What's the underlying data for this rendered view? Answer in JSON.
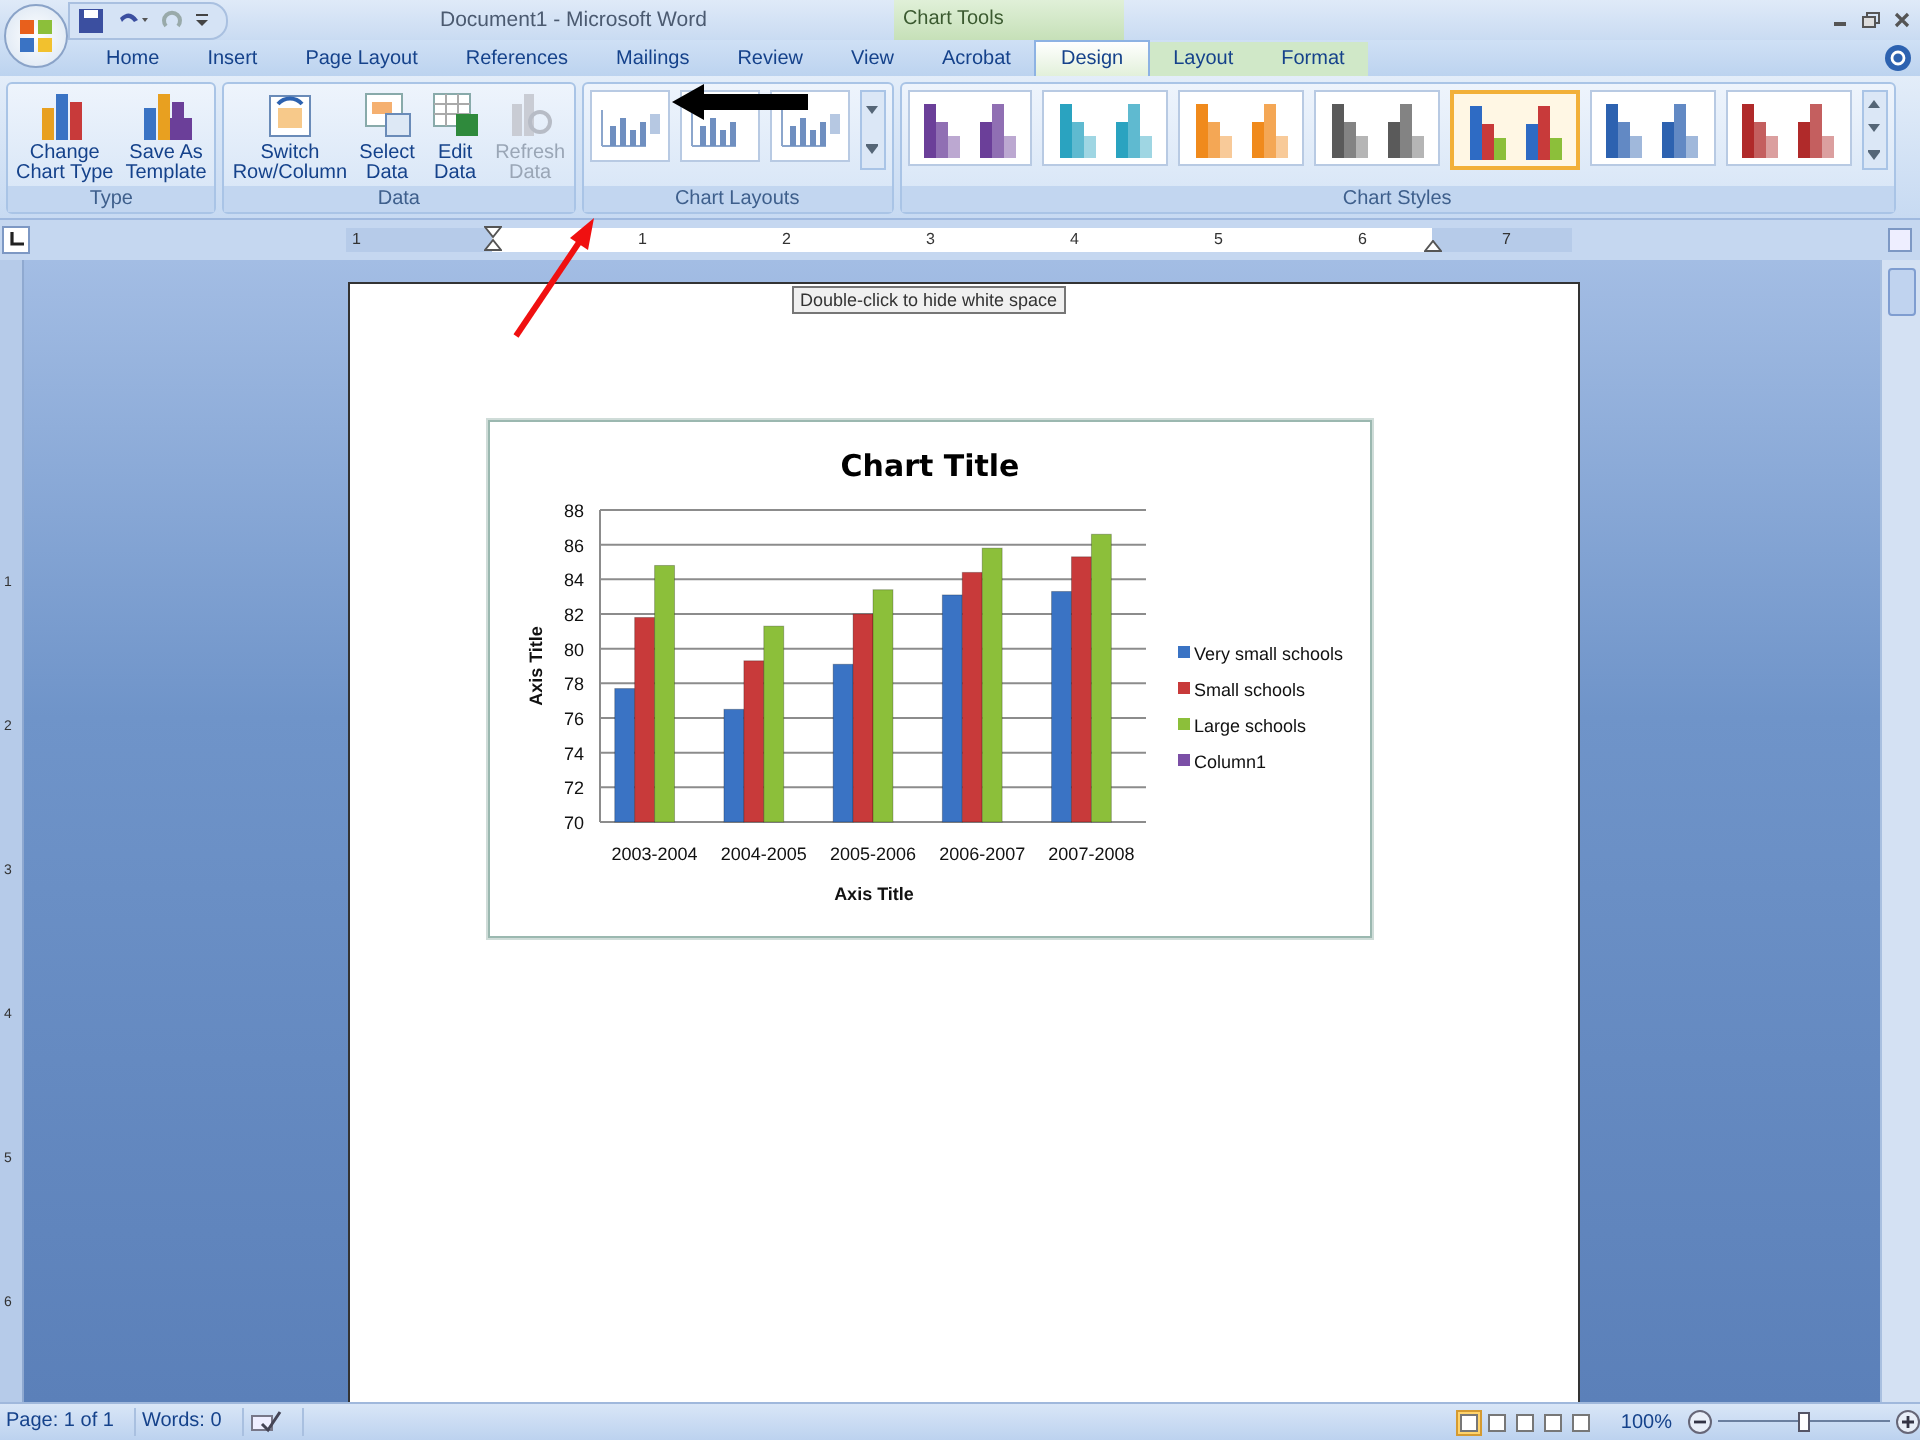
{
  "window": {
    "title": "Document1 - Microsoft Word",
    "context_title": "Chart Tools"
  },
  "tabs": [
    {
      "label": "Home",
      "selected": false,
      "context": false
    },
    {
      "label": "Insert",
      "selected": false,
      "context": false
    },
    {
      "label": "Page Layout",
      "selected": false,
      "context": false
    },
    {
      "label": "References",
      "selected": false,
      "context": false
    },
    {
      "label": "Mailings",
      "selected": false,
      "context": false
    },
    {
      "label": "Review",
      "selected": false,
      "context": false
    },
    {
      "label": "View",
      "selected": false,
      "context": false
    },
    {
      "label": "Acrobat",
      "selected": false,
      "context": false
    },
    {
      "label": "Design",
      "selected": true,
      "context": true
    },
    {
      "label": "Layout",
      "selected": false,
      "context": true
    },
    {
      "label": "Format",
      "selected": false,
      "context": true
    }
  ],
  "ribbon": {
    "type_group": {
      "label": "Type",
      "buttons": [
        {
          "kind": "chart-type",
          "lines": [
            "Change",
            "Chart Type"
          ],
          "disabled": false
        },
        {
          "kind": "template",
          "lines": [
            "Save As",
            "Template"
          ],
          "disabled": false
        }
      ]
    },
    "data_group": {
      "label": "Data",
      "buttons": [
        {
          "kind": "switch",
          "lines": [
            "Switch",
            "Row/Column"
          ],
          "disabled": false
        },
        {
          "kind": "select",
          "lines": [
            "Select",
            "Data"
          ],
          "disabled": false
        },
        {
          "kind": "edit",
          "lines": [
            "Edit",
            "Data"
          ],
          "disabled": false
        },
        {
          "kind": "refresh",
          "lines": [
            "Refresh",
            "Data"
          ],
          "disabled": true
        }
      ]
    },
    "layouts_group": {
      "label": "Chart Layouts",
      "layouts": [
        {
          "kind": "legend-right"
        },
        {
          "kind": "title-top"
        },
        {
          "kind": "legend-right"
        }
      ]
    },
    "styles_group": {
      "label": "Chart Styles",
      "styles": [
        {
          "kind": "single",
          "color": "#6b3f99",
          "selected": false
        },
        {
          "kind": "single",
          "color": "#2aa3c0",
          "selected": false
        },
        {
          "kind": "single",
          "color": "#f08a1c",
          "selected": false
        },
        {
          "kind": "single",
          "color": "#5a5a5a",
          "selected": false
        },
        {
          "kind": "mixed",
          "color": "#2e6bc4",
          "selected": true
        },
        {
          "kind": "single",
          "color": "#2d62b0",
          "selected": false
        },
        {
          "kind": "single",
          "color": "#b02a2a",
          "selected": false
        }
      ]
    }
  },
  "ruler": {
    "labels": [
      "1",
      "1",
      "2",
      "3",
      "4",
      "5",
      "6",
      "7"
    ]
  },
  "vertical_ruler": {
    "labels": [
      "1",
      "2",
      "3",
      "4",
      "5",
      "6"
    ]
  },
  "tooltip": "Double-click to hide white space",
  "chart": {
    "chart_data": {
      "type": "bar",
      "title": "Chart Title",
      "xlabel": "Axis Title",
      "ylabel": "Axis Title",
      "categories": [
        "2003-2004",
        "2004-2005",
        "2005-2006",
        "2006-2007",
        "2007-2008"
      ],
      "series": [
        {
          "name": "Very small schools",
          "color": "#3a73c4",
          "values": [
            77.7,
            76.5,
            79.1,
            83.1,
            83.3
          ]
        },
        {
          "name": "Small schools",
          "color": "#c83a3a",
          "values": [
            81.8,
            79.3,
            82.0,
            84.4,
            85.3
          ]
        },
        {
          "name": "Large schools",
          "color": "#8cbf3a",
          "values": [
            84.8,
            81.3,
            83.4,
            85.8,
            86.6
          ]
        },
        {
          "name": "Column1",
          "color": "#7b4fa6",
          "values": [
            null,
            null,
            null,
            null,
            null
          ]
        }
      ],
      "grid": true,
      "legend": true,
      "ylim": [
        70,
        88
      ],
      "yticks": [
        70,
        72,
        74,
        76,
        78,
        80,
        82,
        84,
        86,
        88
      ]
    }
  },
  "status_bar": {
    "page": "Page: 1 of 1",
    "words": "Words: 0",
    "views": [
      {
        "selected": true
      },
      {
        "selected": false
      },
      {
        "selected": false
      },
      {
        "selected": false
      },
      {
        "selected": false
      }
    ],
    "zoom": "100%",
    "zoom_level": {
      "level": 0.5
    }
  }
}
